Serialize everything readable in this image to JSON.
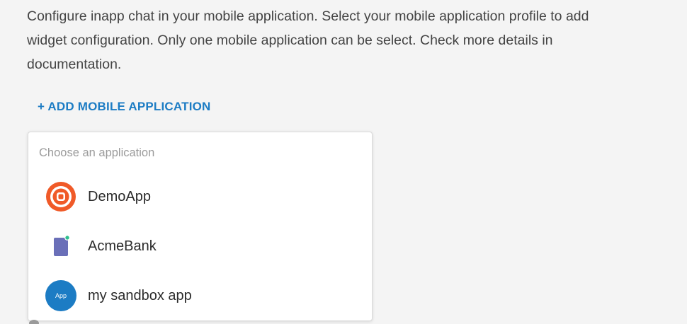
{
  "description": {
    "line1": "Configure inapp chat in your mobile application. Select your mobile application profile to add",
    "line2": "widget configuration. Only one mobile application can be select. Check more details in",
    "line3": "documentation."
  },
  "add_button": {
    "label": "+ ADD MOBILE APPLICATION"
  },
  "dropdown": {
    "header": "Choose an application",
    "items": [
      {
        "label": "DemoApp",
        "icon": "target-icon",
        "color": "#f05a28"
      },
      {
        "label": "AcmeBank",
        "icon": "phone-icon",
        "color": "#6a6fb8"
      },
      {
        "label": "my sandbox app",
        "icon": "app-icon",
        "color": "#1c7cc4",
        "icon_text": "App"
      }
    ]
  },
  "colors": {
    "accent": "#1c7cc4",
    "background": "#f4f4f4",
    "status_dot": "#2fbf8f"
  }
}
